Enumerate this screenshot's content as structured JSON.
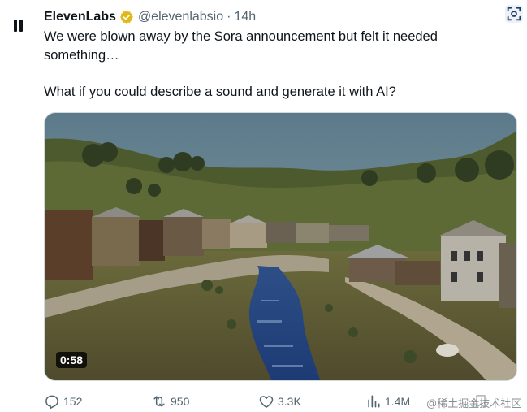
{
  "tweet": {
    "author": {
      "display_name": "ElevenLabs",
      "handle": "@elevenlabsio",
      "separator": "·",
      "time": "14h",
      "verified_color": "#e2b719"
    },
    "text_line1": "We were blown away by the Sora announcement but felt it needed",
    "text_line2": "something…",
    "text_para2": "What if you could describe a sound and generate it with AI?",
    "media": {
      "duration": "0:58"
    },
    "actions": {
      "replies": "152",
      "reposts": "950",
      "likes": "3.3K",
      "views": "1.4M"
    }
  },
  "watermark": "@稀土掘金技术社区",
  "icons": [
    "pause-icon",
    "verified-badge-icon",
    "grok-image-icon",
    "reply-icon",
    "repost-icon",
    "like-icon",
    "views-icon",
    "bookmark-icon"
  ],
  "colors": {
    "text_primary": "#0f1419",
    "text_secondary": "#536471",
    "border": "#cfd9de"
  }
}
